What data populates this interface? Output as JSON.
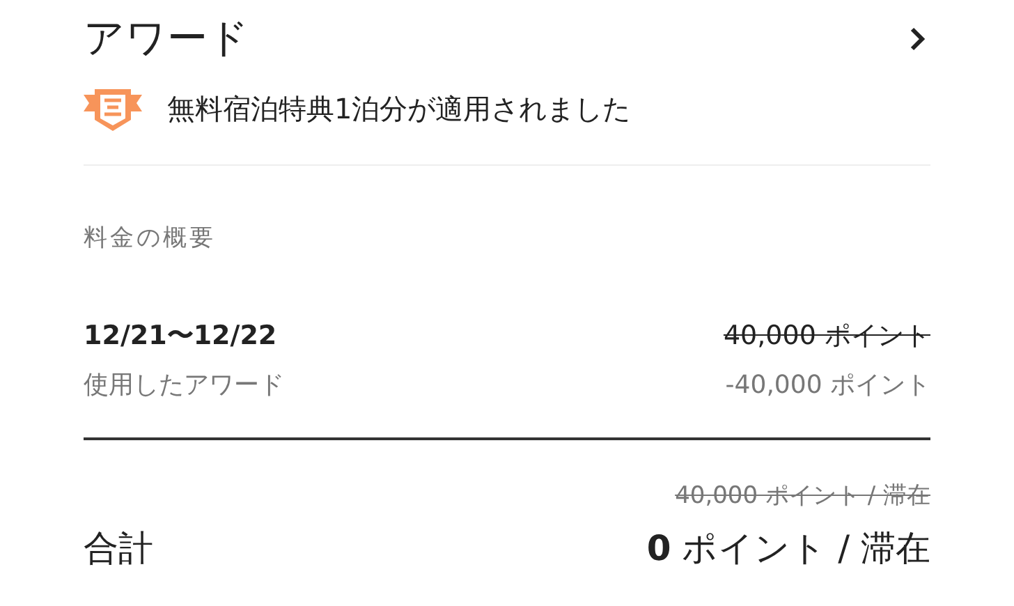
{
  "award": {
    "title": "アワード",
    "applied": "無料宿泊特典1泊分が適用されました"
  },
  "summary": {
    "heading": "料金の概要",
    "dates": "12/21〜12/22",
    "original_price": "40,000 ポイント",
    "award_label": "使用したアワード",
    "award_amount": "-40,000 ポイント"
  },
  "total": {
    "label": "合計",
    "original": "40,000 ポイント / 滞在",
    "amount": "**0** ポイント / 滞在"
  }
}
